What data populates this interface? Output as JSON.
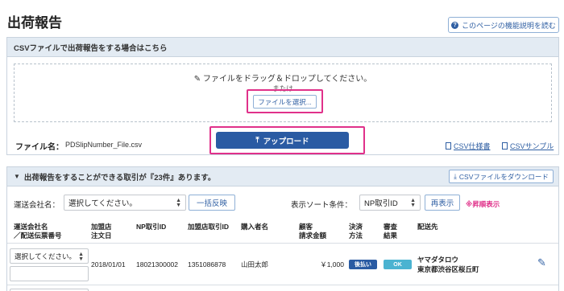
{
  "page": {
    "title": "出荷報告",
    "help_button": "このページの機能説明を読む"
  },
  "csv_panel": {
    "title": "CSVファイルで出荷報告をする場合はこちら",
    "drop_text": "ファイルをドラッグ＆ドロップしてください。",
    "or_text": "または",
    "select_file_button": "ファイルを選択...",
    "file_name_label": "ファイル名：",
    "file_name_value": "PDSlipNumber_File.csv",
    "upload_button": "アップロード",
    "csv_spec_link": "CSV仕様書",
    "csv_sample_link": "CSVサンプル"
  },
  "orders_panel": {
    "title": "出荷報告をすることができる取引が『23件』あります。",
    "download_button": "CSVファイルをダウンロード",
    "carrier_label": "運送会社名：",
    "carrier_select": "選択してください。",
    "apply_all_button": "一括反映",
    "sort_label": "表示ソート条件：",
    "sort_select": "NP取引ID",
    "redisplay_button": "再表示",
    "sort_note": "※昇順表示",
    "columns": [
      "運送会社名\n／配送伝票番号",
      "加盟店\n注文日",
      "NP取引ID",
      "加盟店取引ID",
      "購入者名",
      "顧客\n請求金額",
      "決済\n方法",
      "審査\n結果",
      "配送先"
    ],
    "rows": [
      {
        "carrier_select": "選択してください。",
        "order_date": "2018/01/01",
        "np_id": "18021300002",
        "merchant_id": "1351086878",
        "buyer": "山田太郎",
        "amount": "￥1,000",
        "payment": "後払い",
        "review": "OK",
        "ship_name": "ヤマダタロウ",
        "ship_address": "東京都渋谷区桜丘町"
      }
    ]
  },
  "colors": {
    "primary": "#2a5ba3",
    "highlight": "#e0318a",
    "ok_badge": "#4bb3d1",
    "payment_badge": "#2a5ba3"
  }
}
